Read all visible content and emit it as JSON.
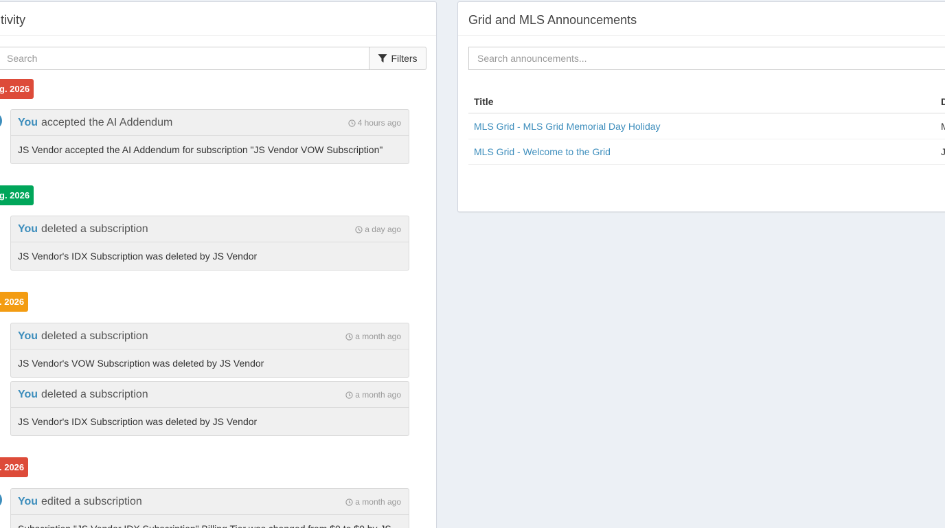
{
  "activity": {
    "title": "tivity",
    "search_placeholder": "Search",
    "filters_label": "Filters",
    "groups": [
      {
        "date": "g. 2026",
        "color": "#dd4b39",
        "items": [
          {
            "actor": "You",
            "action": "accepted the AI Addendum",
            "time": "4 hours ago",
            "body": "JS Vendor accepted the AI Addendum for subscription \"JS Vendor VOW Subscription\""
          }
        ]
      },
      {
        "date": "g. 2026",
        "color": "#00a65a",
        "items": [
          {
            "actor": "You",
            "action": "deleted a subscription",
            "time": "a day ago",
            "body": "JS Vendor's IDX Subscription was deleted by JS Vendor"
          }
        ]
      },
      {
        "date": ". 2026",
        "color": "#f39c12",
        "items": [
          {
            "actor": "You",
            "action": "deleted a subscription",
            "time": "a month ago",
            "body": "JS Vendor's VOW Subscription was deleted by JS Vendor"
          },
          {
            "actor": "You",
            "action": "deleted a subscription",
            "time": "a month ago",
            "body": "JS Vendor's IDX Subscription was deleted by JS Vendor"
          }
        ]
      },
      {
        "date": ". 2026",
        "color": "#dd4b39",
        "items": [
          {
            "actor": "You",
            "action": "edited a subscription",
            "time": "a month ago",
            "body": "Subscription \"JS Vendor IDX Subscription\" Billing Tier was changed from $0 to $0 by JS"
          }
        ]
      }
    ]
  },
  "announcements": {
    "title": "Grid and MLS Announcements",
    "search_placeholder": "Search announcements...",
    "columns": [
      "Title",
      "D"
    ],
    "rows": [
      {
        "title": "MLS Grid - MLS Grid Memorial Day Holiday",
        "date": "M"
      },
      {
        "title": "MLS Grid - Welcome to the Grid",
        "date": "J"
      }
    ]
  }
}
